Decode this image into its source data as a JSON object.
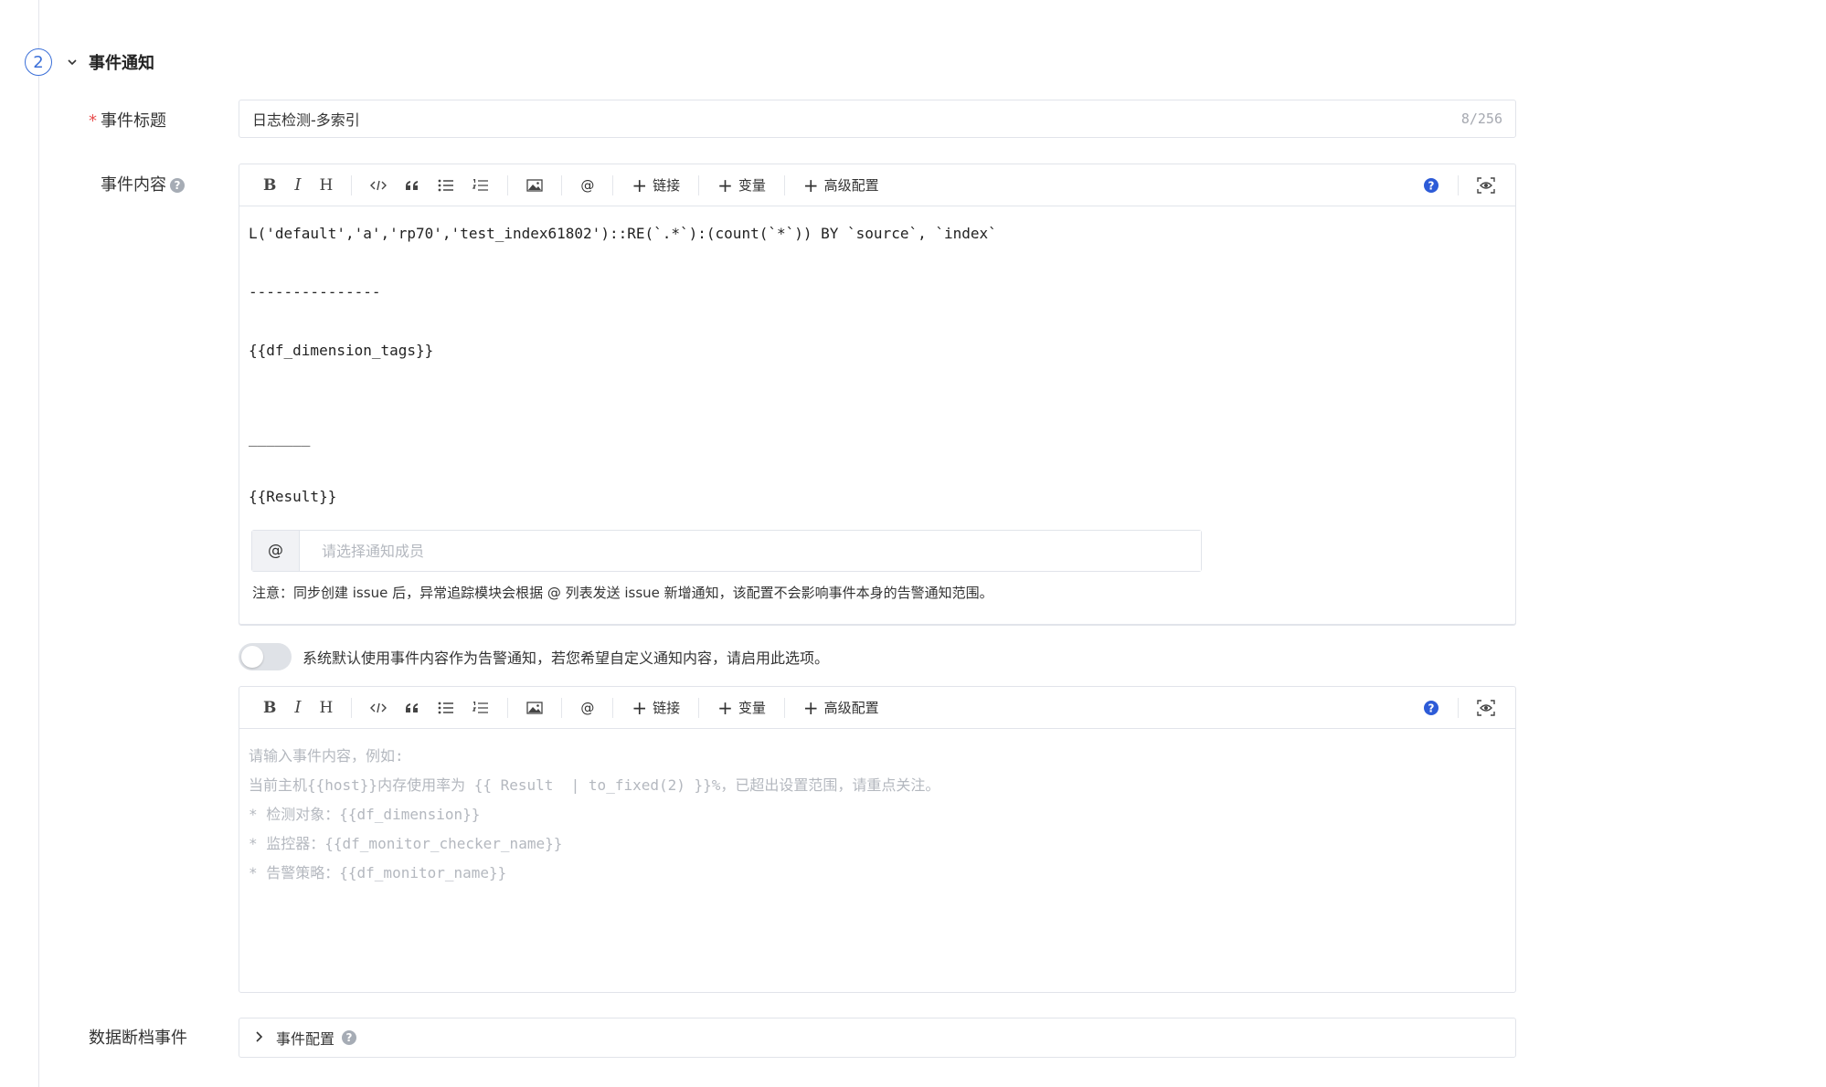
{
  "section": {
    "step": "2",
    "title": "事件通知"
  },
  "event_title": {
    "label": "事件标题",
    "required_mark": "*",
    "value": "日志检测-多索引",
    "count": "8/256"
  },
  "event_content": {
    "label": "事件内容",
    "toolbar": {
      "link": "链接",
      "variable": "变量",
      "advanced": "高级配置",
      "at": "@"
    },
    "lines": [
      "L('default','a','rp70','test_index61802')::RE(`.*`):(count(`*`)) BY `source`, `index`",
      "",
      "---------------",
      "",
      "{{df_dimension_tags}}",
      "",
      "",
      "_______",
      "",
      "{{Result}}"
    ]
  },
  "notify": {
    "at_prefix": "@",
    "placeholder": "请选择通知成员",
    "note": "注意：同步创建 issue 后，异常追踪模块会根据 @ 列表发送 issue 新增通知，该配置不会影响事件本身的告警通知范围。"
  },
  "custom_toggle": {
    "on": false,
    "text": "系统默认使用事件内容作为告警通知，若您希望自定义通知内容，请启用此选项。"
  },
  "custom_content": {
    "toolbar": {
      "link": "链接",
      "variable": "变量",
      "advanced": "高级配置",
      "at": "@"
    },
    "placeholder_lines": [
      "请输入事件内容，例如:",
      "当前主机{{host}}内存使用率为 {{ Result  | to_fixed(2) }}%，已超出设置范围，请重点关注。",
      "* 检测对象：{{df_dimension}}",
      "* 监控器：{{df_monitor_checker_name}}",
      "* 告警策略：{{df_monitor_name}}"
    ]
  },
  "data_gap": {
    "label": "数据断档事件",
    "collapse_label": "事件配置"
  },
  "colors": {
    "accent": "#3a6fd8",
    "required": "#e84f4f",
    "help_blue": "#2d5bd7"
  }
}
